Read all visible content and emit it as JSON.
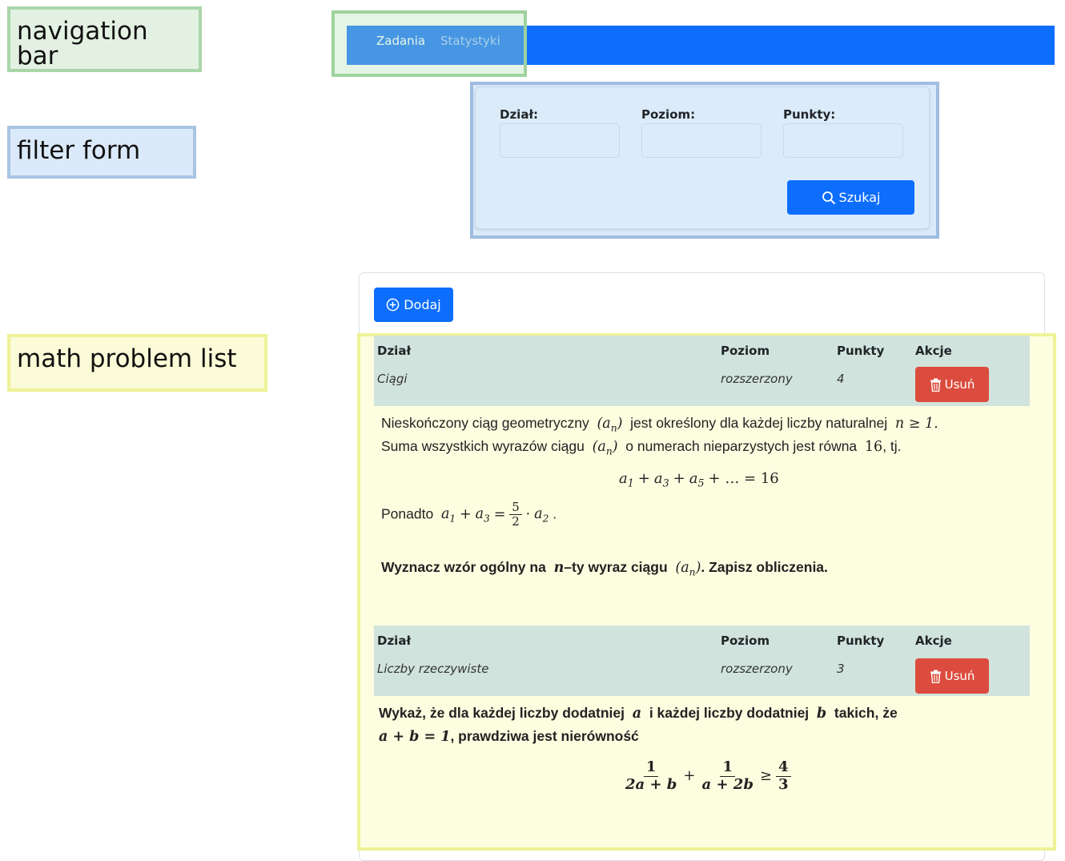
{
  "annotations": {
    "navigation": "navigation bar",
    "filter": "filter form",
    "list": "math problem list"
  },
  "navbar": {
    "links": [
      {
        "label": "Zadania",
        "active": true
      },
      {
        "label": "Statystyki",
        "active": false
      }
    ]
  },
  "filter": {
    "fields": [
      {
        "label": "Dział:",
        "value": ""
      },
      {
        "label": "Poziom:",
        "value": ""
      },
      {
        "label": "Punkty:",
        "value": ""
      }
    ],
    "search_label": "Szukaj",
    "search_icon": "search-icon"
  },
  "list": {
    "add_label": "Dodaj",
    "add_icon": "plus-circle-icon",
    "columns": [
      "Dział",
      "Poziom",
      "Punkty",
      "Akcje"
    ],
    "delete_label": "Usuń",
    "delete_icon": "trash-icon",
    "problems": [
      {
        "dzial": "Ciągi",
        "poziom": "rozszerzony",
        "punkty": "4",
        "content": {
          "l1a": "Nieskończony ciąg geometryczny",
          "l1b": "jest określony dla każdej liczby naturalnej",
          "l1c": "n ≥ 1.",
          "l2a": "Suma wszystkich wyrazów ciągu",
          "l2b": "o numerach nieparzystych jest równa",
          "l2c": "16",
          "l2d": ", tj.",
          "eq1_rhs": "= 16",
          "l3a": "Ponadto",
          "frac_num": "5",
          "frac_den": "2",
          "l4a": "Wyznacz wzór ogólny na",
          "l4b": "n",
          "l4c": "–ty wyraz ciągu",
          "l4d": ". Zapisz obliczenia."
        }
      },
      {
        "dzial": "Liczby rzeczywiste",
        "poziom": "rozszerzony",
        "punkty": "3",
        "content": {
          "l1a": "Wykaż, że dla każdej liczby dodatniej",
          "l1b": "a",
          "l1c": "i każdej liczby dodatniej",
          "l1d": "b",
          "l1e": "takich, że",
          "l2a": "a + b = 1",
          "l2b": ", prawdziwa jest nierówność",
          "f1_num": "1",
          "f1_den": "2a + b",
          "f2_num": "1",
          "f2_den": "a + 2b",
          "f3_num": "4",
          "f3_den": "3"
        }
      }
    ]
  }
}
